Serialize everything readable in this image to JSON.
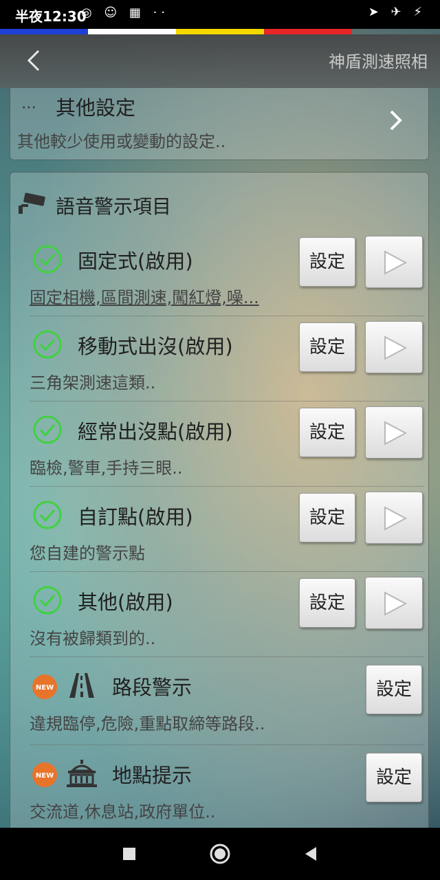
{
  "status_bar": {
    "time": "半夜12:30",
    "left_icons": "◎ ☺ ▦ ··",
    "right_icons": "➤ ✈ ⚡"
  },
  "action_bar": {
    "back_glyph": "〈",
    "title": "神盾測速照相"
  },
  "other_settings": {
    "icon": "⋯",
    "title": "其他設定",
    "subtitle": "其他較少使用或變動的設定..",
    "chevron": "›"
  },
  "voice_section": {
    "title": "語音警示項目",
    "items": [
      {
        "title": "固定式(啟用)",
        "subtitle": "固定相機,區間測速,闖紅燈,噪...",
        "set_label": "設定"
      },
      {
        "title": "移動式出沒(啟用)",
        "subtitle": "三角架測速這類..",
        "set_label": "設定"
      },
      {
        "title": "經常出沒點(啟用)",
        "subtitle": "臨檢,警車,手持三眼..",
        "set_label": "設定"
      },
      {
        "title": "自訂點(啟用)",
        "subtitle": "您自建的警示點",
        "set_label": "設定"
      },
      {
        "title": "其他(啟用)",
        "subtitle": "沒有被歸類到的..",
        "set_label": "設定"
      }
    ],
    "new_items": [
      {
        "badge": "NEW",
        "title": "路段警示",
        "subtitle": "違規臨停,危險,重點取締等路段..",
        "set_label": "設定"
      },
      {
        "badge": "NEW",
        "title": "地點提示",
        "subtitle": "交流道,休息站,政府單位..",
        "set_label": "設定"
      }
    ]
  },
  "colors": {
    "accent_green": "#3fd23f",
    "badge_orange": "#e8742a"
  }
}
